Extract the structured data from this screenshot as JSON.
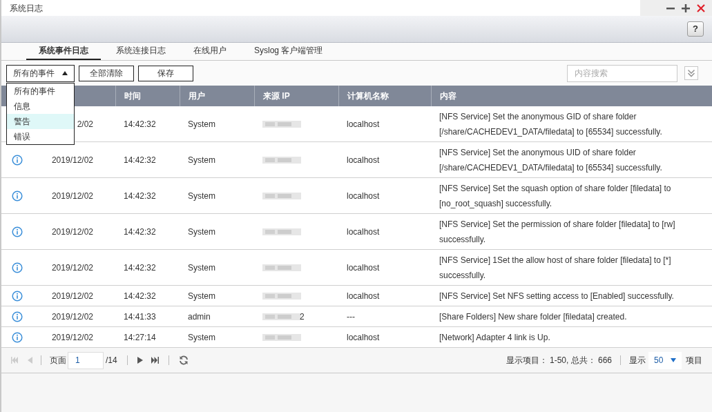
{
  "window": {
    "title": "系统日志",
    "help_label": "?"
  },
  "tabs": [
    {
      "label": "系统事件日志",
      "selected": true
    },
    {
      "label": "系统连接日志",
      "selected": false
    },
    {
      "label": "在线用户",
      "selected": false
    },
    {
      "label": "Syslog 客户端管理",
      "selected": false
    }
  ],
  "toolbar": {
    "filter": {
      "value": "所有的事件",
      "expanded": true,
      "options": [
        {
          "label": "所有的事件",
          "hovered": false
        },
        {
          "label": "信息",
          "hovered": false
        },
        {
          "label": "警告",
          "hovered": true
        },
        {
          "label": "错误",
          "hovered": false
        }
      ]
    },
    "buttons": [
      "全部清除",
      "保存"
    ],
    "search": {
      "placeholder": "内容搜索"
    }
  },
  "table": {
    "columns": [
      "",
      "时间",
      "用户",
      "来源 IP",
      "计算机名称",
      "内容"
    ],
    "rows": [
      {
        "kind": "covered",
        "date": "2/02",
        "time": "14:42:32",
        "user": "System",
        "computer": "localhost",
        "content": [
          "[NFS Service] Set the anonymous GID of share folder",
          "[/share/CACHEDEV1_DATA/filedata] to [65534] successfully."
        ]
      },
      {
        "kind": "info",
        "date": "2019/12/02",
        "time": "14:42:32",
        "user": "System",
        "computer": "localhost",
        "content": [
          "[NFS Service] Set the anonymous UID of share folder",
          "[/share/CACHEDEV1_DATA/filedata] to [65534] successfully."
        ]
      },
      {
        "kind": "info",
        "date": "2019/12/02",
        "time": "14:42:32",
        "user": "System",
        "computer": "localhost",
        "content": [
          "[NFS Service] Set the squash option of share folder [filedata] to",
          "[no_root_squash] successfully."
        ]
      },
      {
        "kind": "info",
        "date": "2019/12/02",
        "time": "14:42:32",
        "user": "System",
        "computer": "localhost",
        "content": [
          "[NFS Service] Set the permission of share folder [filedata] to [rw]",
          "successfully."
        ]
      },
      {
        "kind": "info",
        "date": "2019/12/02",
        "time": "14:42:32",
        "user": "System",
        "computer": "localhost",
        "content": [
          "[NFS Service] 1Set the allow host of share folder [filedata] to [*]",
          "successfully."
        ]
      },
      {
        "kind": "info",
        "date": "2019/12/02",
        "time": "14:42:32",
        "user": "System",
        "computer": "localhost",
        "content": [
          "[NFS Service] Set NFS setting access to [Enabled] successfully."
        ]
      },
      {
        "kind": "info",
        "date": "2019/12/02",
        "time": "14:41:33",
        "user": "admin",
        "ip_visible": "2",
        "computer": "---",
        "content": [
          "[Share Folders] New share folder [filedata] created."
        ]
      },
      {
        "kind": "info",
        "date": "2019/12/02",
        "time": "14:27:14",
        "user": "System",
        "computer": "localhost",
        "content": [
          "[Network] Adapter 4 link is Up."
        ]
      }
    ]
  },
  "pager": {
    "page_label": "页面",
    "page": "1",
    "total_pages": "/14",
    "summary": "显示项目： 1-50, 总共： 666",
    "show_label": "显示",
    "page_size": "50",
    "items_label": "项目"
  }
}
